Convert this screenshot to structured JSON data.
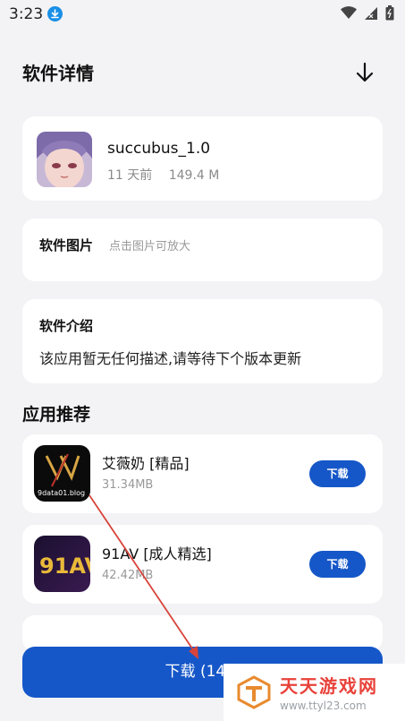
{
  "status_bar": {
    "time": "3:23"
  },
  "header": {
    "title": "软件详情"
  },
  "app": {
    "name": "succubus_1.0",
    "age": "11 天前",
    "size": "149.4 M"
  },
  "pictures": {
    "label": "软件图片",
    "hint": "点击图片可放大"
  },
  "intro": {
    "label": "软件介绍",
    "text": "该应用暂无任何描述,请等待下个版本更新"
  },
  "recommend": {
    "title": "应用推荐",
    "items": [
      {
        "name": "艾薇奶 [精品]",
        "size": "31.34MB",
        "button": "下载",
        "icon_caption": "9data01.blog"
      },
      {
        "name": "91AV [成人精选]",
        "size": "42.42MB",
        "button": "下载",
        "icon_caption": "91AV"
      }
    ]
  },
  "download_button": {
    "label": "下载 (149."
  },
  "watermark": {
    "text": "天天游戏网",
    "url": "www.ttyl23.com"
  },
  "colors": {
    "primary": "#1557c8",
    "background": "#f3f3f5",
    "watermark_red": "#e8423a"
  }
}
